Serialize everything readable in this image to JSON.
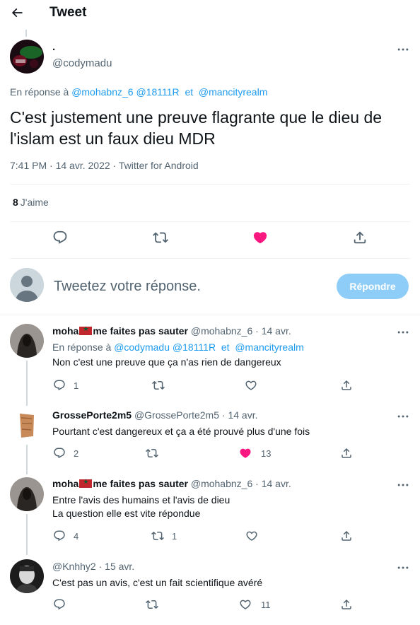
{
  "header": {
    "title": "Tweet"
  },
  "main_tweet": {
    "name": ".",
    "handle": "@codymadu",
    "reply_prefix": "En réponse à",
    "reply_handles": [
      "@mohabnz_6",
      "@18111R",
      "@mancityrealm"
    ],
    "reply_and": "et",
    "text": "C'est justement une preuve flagrante que le dieu de l'islam est un faux dieu MDR",
    "time": "7:41 PM",
    "date": "14 avr. 2022",
    "source": "Twitter for Android",
    "dot": "·",
    "likes_count": "8",
    "likes_label": "J'aime",
    "liked": true
  },
  "compose": {
    "placeholder": "Tweetez votre réponse.",
    "button": "Répondre"
  },
  "replies": [
    {
      "name_a": "moha",
      "name_b": "me faites pas sauter",
      "has_flag": true,
      "handle": "@mohabnz_6",
      "date": "14 avr.",
      "reply_prefix": "En réponse à",
      "reply_handles": [
        "@codymadu",
        "@18111R",
        "@mancityrealm"
      ],
      "reply_and": "et",
      "text_lines": [
        "Non c'est une preuve que ça n'as rien de dangereux"
      ],
      "reply_count": "1",
      "retweet_count": "",
      "like_count": "",
      "liked": false
    },
    {
      "name_a": "GrossePorte2m5",
      "name_b": "",
      "has_flag": false,
      "handle": "@GrossePorte2m5",
      "date": "14 avr.",
      "text_lines": [
        "Pourtant c'est dangereux et ça a été prouvé plus d'une fois"
      ],
      "reply_count": "2",
      "retweet_count": "",
      "like_count": "13",
      "liked": true
    },
    {
      "name_a": "moha",
      "name_b": "me faites pas sauter",
      "has_flag": true,
      "handle": "@mohabnz_6",
      "date": "14 avr.",
      "text_lines": [
        "Entre l'avis des humains et l'avis de dieu",
        "La question elle est vite répondue"
      ],
      "reply_count": "4",
      "retweet_count": "1",
      "like_count": "",
      "liked": false
    },
    {
      "name_a": "",
      "name_b": "",
      "has_flag": false,
      "handle": "@Knhhy2",
      "date": "15 avr.",
      "text_lines": [
        "C'est pas un avis, c'est un fait scientifique avéré"
      ],
      "reply_count": "",
      "retweet_count": "",
      "like_count": "11",
      "liked": false
    }
  ],
  "colors": {
    "accent": "#1d9bf0",
    "like": "#f91880",
    "muted": "#536471",
    "button_disabled": "#8ecdf8"
  },
  "icons": [
    "back-arrow-icon",
    "more-icon",
    "reply-icon",
    "retweet-icon",
    "like-icon",
    "share-icon",
    "default-avatar-icon"
  ]
}
